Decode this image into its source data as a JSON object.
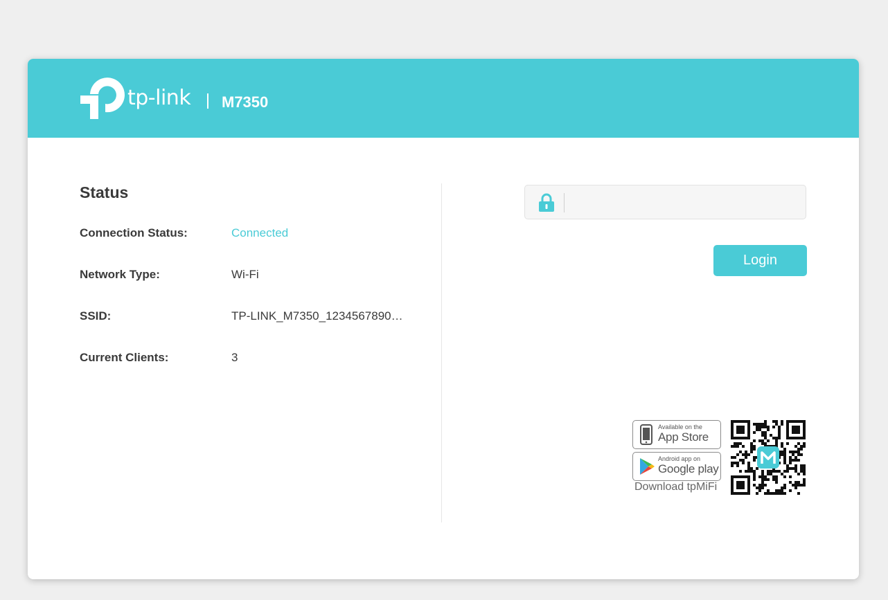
{
  "header": {
    "brand": "tp-link",
    "model": "M7350",
    "accent_color": "#4acbd6"
  },
  "status": {
    "title": "Status",
    "rows": [
      {
        "label": "Connection Status:",
        "value": "Connected"
      },
      {
        "label": "Network Type:",
        "value": "Wi-Fi"
      },
      {
        "label": "SSID:",
        "value": "TP-LINK_M7350_1234567890…"
      },
      {
        "label": "Current Clients:",
        "value": "3"
      }
    ]
  },
  "login": {
    "password_value": "",
    "button_label": "Login",
    "lock_icon": "lock-icon"
  },
  "apps": {
    "app_store": {
      "small": "Available on the",
      "big": "App Store"
    },
    "google_play": {
      "small": "Android app on",
      "big": "Google play"
    },
    "caption": "Download tpMiFi",
    "qr_icon": "qr-code"
  }
}
